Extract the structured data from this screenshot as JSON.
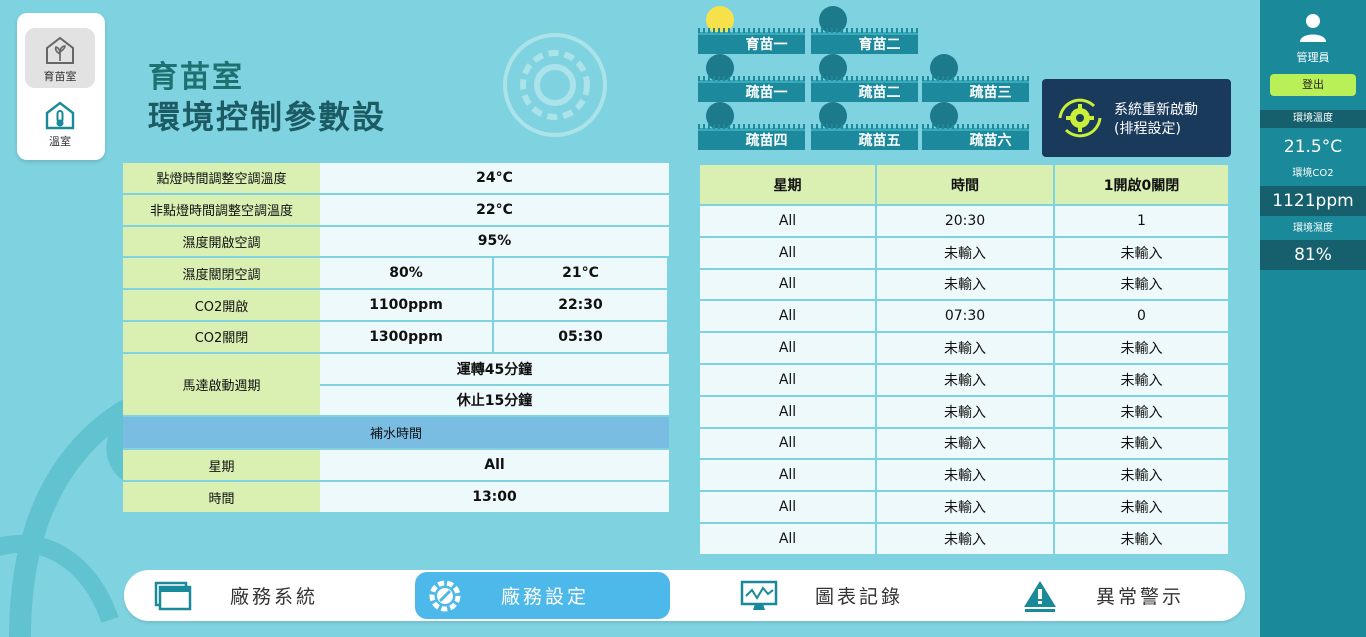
{
  "nav": [
    {
      "label": "育苗室",
      "icon": "greenhouse-icon",
      "active": true
    },
    {
      "label": "溫室",
      "icon": "thermometer-house-icon",
      "active": false
    }
  ],
  "title": {
    "line1": "育苗室",
    "line2": "環境控制參數設"
  },
  "params": {
    "light_on_temp": {
      "label": "點燈時間調整空調溫度",
      "value": "24°C"
    },
    "light_off_temp": {
      "label": "非點燈時間調整空調溫度",
      "value": "22°C"
    },
    "humid_on": {
      "label": "濕度開啟空調",
      "value": "95%"
    },
    "humid_off": {
      "label": "濕度關閉空調",
      "value1": "80%",
      "value2": "21°C"
    },
    "co2_on": {
      "label": "CO2開啟",
      "value1": "1100ppm",
      "value2": "22:30"
    },
    "co2_off": {
      "label": "CO2關閉",
      "value1": "1300ppm",
      "value2": "05:30"
    },
    "motor": {
      "label": "馬達啟動週期",
      "run": "運轉45分鐘",
      "rest": "休止15分鐘"
    },
    "refill_section": "補水時間",
    "refill_day": {
      "label": "星期",
      "value": "All"
    },
    "refill_time": {
      "label": "時間",
      "value": "13:00"
    }
  },
  "bulbs": [
    {
      "label": "育苗一",
      "on": true
    },
    {
      "label": "育苗二",
      "on": false
    },
    {
      "label": "疏苗一",
      "on": false
    },
    {
      "label": "疏苗二",
      "on": false
    },
    {
      "label": "疏苗三",
      "on": false
    },
    {
      "label": "疏苗四",
      "on": false
    },
    {
      "label": "疏苗五",
      "on": false
    },
    {
      "label": "疏苗六",
      "on": false
    }
  ],
  "restart": {
    "line1": "系統重新啟動",
    "line2": "(排程設定)"
  },
  "schedule": {
    "headers": [
      "星期",
      "時間",
      "1開啟0關閉"
    ],
    "rows": [
      [
        "All",
        "20:30",
        "1"
      ],
      [
        "All",
        "未輸入",
        "未輸入"
      ],
      [
        "All",
        "未輸入",
        "未輸入"
      ],
      [
        "All",
        "07:30",
        "0"
      ],
      [
        "All",
        "未輸入",
        "未輸入"
      ],
      [
        "All",
        "未輸入",
        "未輸入"
      ],
      [
        "All",
        "未輸入",
        "未輸入"
      ],
      [
        "All",
        "未輸入",
        "未輸入"
      ],
      [
        "All",
        "未輸入",
        "未輸入"
      ],
      [
        "All",
        "未輸入",
        "未輸入"
      ],
      [
        "All",
        "未輸入",
        "未輸入"
      ]
    ]
  },
  "sidebar": {
    "role": "管理員",
    "logout": "登出",
    "temp_label": "環境溫度",
    "temp_value": "21.5°C",
    "co2_label": "環境CO2",
    "co2_value": "1121ppm",
    "humid_label": "環境濕度",
    "humid_value": "81%"
  },
  "bottom_nav": [
    {
      "label": "廠務系統",
      "icon": "windows-icon",
      "active": false
    },
    {
      "label": "廠務設定",
      "icon": "wrench-gear-icon",
      "active": true
    },
    {
      "label": "圖表記錄",
      "icon": "monitor-chart-icon",
      "active": false
    },
    {
      "label": "異常警示",
      "icon": "warning-icon",
      "active": false
    }
  ],
  "colors": {
    "bg": "#7fd3e0",
    "label_bg": "#d9f0b2",
    "section_bg": "#7abde3",
    "sidebar": "#1a8a9a",
    "bulb_on": "#f7e14a",
    "bulb_off": "#1c7a8a"
  }
}
